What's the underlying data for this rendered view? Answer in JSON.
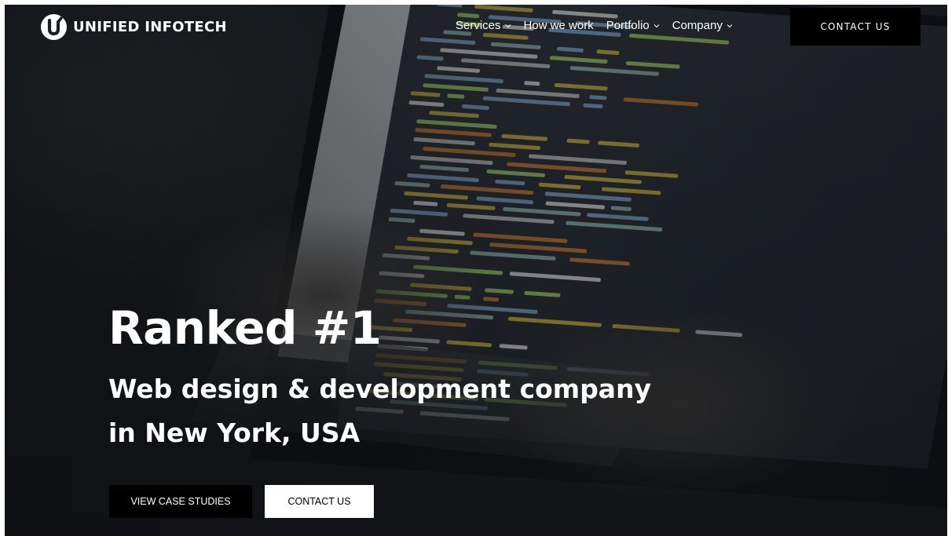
{
  "brand": {
    "name": "UNIFIED INFOTECH",
    "logo_icon": "unified-infotech-logo-mark"
  },
  "nav": {
    "items": [
      {
        "label": "Services",
        "has_dropdown": true
      },
      {
        "label": "How we work",
        "has_dropdown": false
      },
      {
        "label": "Portfolio",
        "has_dropdown": true
      },
      {
        "label": "Company",
        "has_dropdown": true
      }
    ],
    "contact_label": "CONTACT US"
  },
  "hero": {
    "title": "Ranked #1",
    "subtitle_line1": "Web design & development company",
    "subtitle_line2": "in New York, USA",
    "primary_cta": "VIEW CASE STUDIES",
    "secondary_cta": "CONTACT US"
  },
  "colors": {
    "button_dark": "#000000",
    "button_light": "#ffffff",
    "text": "#ffffff"
  }
}
